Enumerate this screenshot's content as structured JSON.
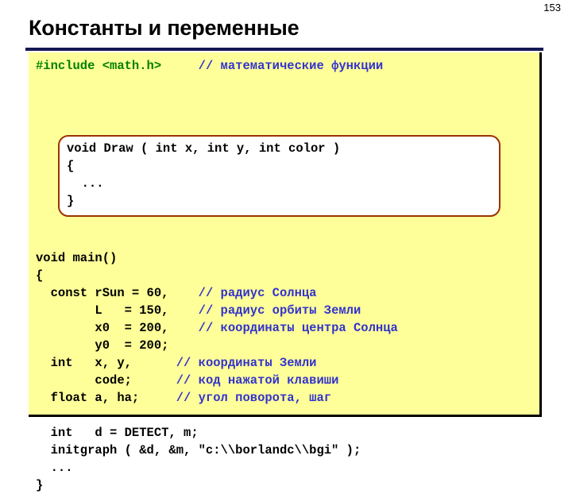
{
  "slide": {
    "page_number": "153",
    "title": "Константы и переменные",
    "accent_navy": "#141852",
    "panel_background": "#ffff99",
    "comment_color": "#3333cc",
    "preprocessor_color": "#008000",
    "inset_border_color": "#993300"
  },
  "code": {
    "include_directive": "#include <math.h>",
    "include_comment": "// математические функции",
    "draw_function": "void Draw ( int x, int y, int color )\n{\n  ...\n}",
    "main_lines": [
      "void main()",
      "{",
      "  const rSun = 60,",
      "        L   = 150,",
      "        x0  = 200,",
      "        y0  = 200;",
      "  int   x, y,",
      "        code;",
      "  float a, ha;",
      "",
      "  int   d = DETECT, m;",
      "  initgraph ( &d, &m, \"c:\\\\borlandc\\\\bgi\" );",
      "  ...",
      "}"
    ],
    "main_body_plain": "void main()\n{\n  const rSun = 60,\n        L   = 150,\n        x0  = 200,\n        y0  = 200;\n  int   x, y,\n        code;\n  float a, ha;\n\n  int   d = DETECT, m;\n  initgraph ( &d, &m, \"c:\\\\borlandc\\\\bgi\" );\n  ...\n}",
    "comments": [
      "// радиус Солнца",
      "// радиус орбиты Земли",
      "// координаты центра Солнца",
      "// координаты Земли",
      "// код нажатой клавиши",
      "// угол поворота, шаг"
    ]
  }
}
